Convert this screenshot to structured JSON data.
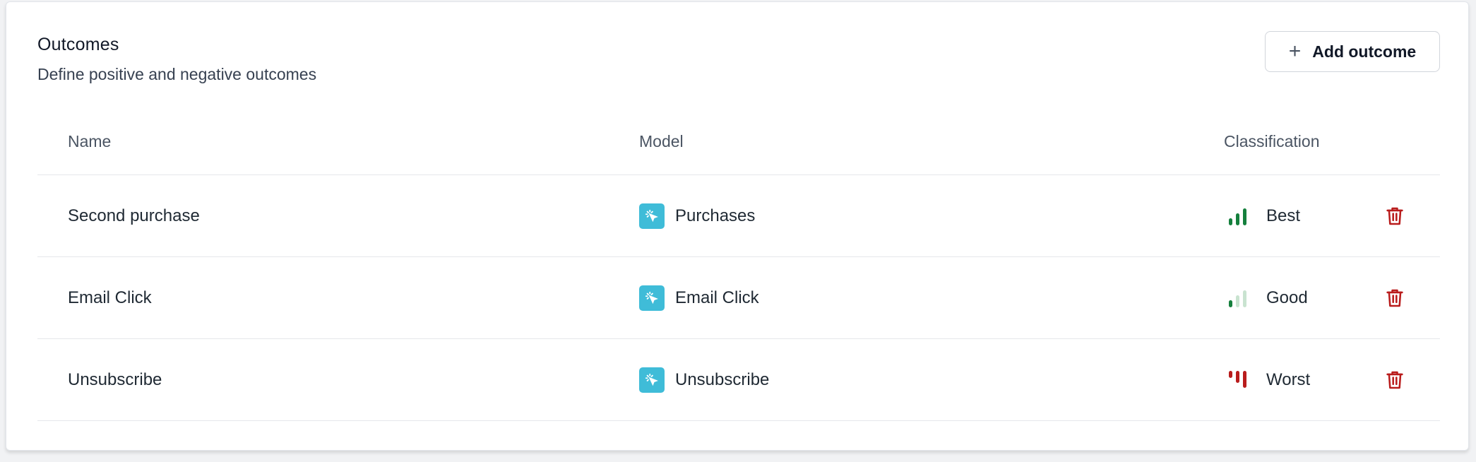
{
  "header": {
    "title": "Outcomes",
    "subtitle": "Define positive and negative outcomes"
  },
  "toolbar": {
    "add_label": "Add outcome",
    "add_icon": "plus-icon"
  },
  "table": {
    "columns": [
      "Name",
      "Model",
      "Classification"
    ],
    "rows": [
      {
        "name": "Second purchase",
        "model": "Purchases",
        "classification": "Best",
        "level": 3,
        "status_color": "#15803d"
      },
      {
        "name": "Email Click",
        "model": "Email Click",
        "classification": "Good",
        "level": 1,
        "status_color": "#15803d"
      },
      {
        "name": "Unsubscribe",
        "model": "Unsubscribe",
        "classification": "Worst",
        "level": 3,
        "status_color": "#b91c1c"
      }
    ]
  },
  "colors": {
    "model_icon_bg": "#3fbcd8",
    "delete": "#b91c1c"
  }
}
